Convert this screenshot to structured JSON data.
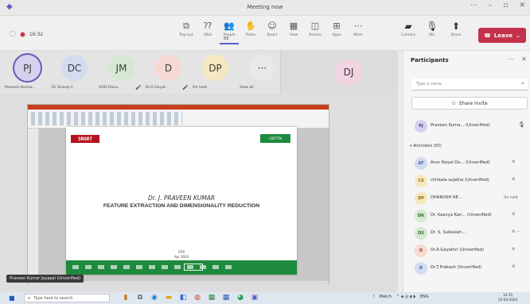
{
  "window": {
    "title": "Meeting now"
  },
  "toolbar": {
    "timer": "16:32",
    "tools": [
      {
        "label": "Pop out",
        "icon": "popout-icon",
        "glyph": "⧉"
      },
      {
        "label": "Q&A",
        "icon": "qa-icon",
        "glyph": "⁇"
      },
      {
        "label": "People",
        "icon": "people-icon",
        "glyph": "👥",
        "count": "88"
      },
      {
        "label": "Raise",
        "icon": "raise-hand-icon",
        "glyph": "✋"
      },
      {
        "label": "React",
        "icon": "react-icon",
        "glyph": "☺"
      },
      {
        "label": "View",
        "icon": "view-icon",
        "glyph": "▦"
      },
      {
        "label": "Rooms",
        "icon": "rooms-icon",
        "glyph": "◫"
      },
      {
        "label": "Apps",
        "icon": "apps-icon",
        "glyph": "⊞"
      },
      {
        "label": "More",
        "icon": "more-icon",
        "glyph": "⋯"
      }
    ],
    "devices": [
      {
        "label": "Camera",
        "icon": "camera-off-icon",
        "glyph": "▰"
      },
      {
        "label": "Mic",
        "icon": "mic-off-icon",
        "glyph": "🎙"
      },
      {
        "label": "Share",
        "icon": "share-icon",
        "glyph": "⬆"
      }
    ],
    "leave": "Leave"
  },
  "strip": {
    "tiles": [
      {
        "initials": "PJ",
        "name": "Praveen Kumar...",
        "bg": "#d7d0ee",
        "ring": "#6b59b8",
        "mic": false
      },
      {
        "initials": "DC",
        "name": "Dr Sivaraj C",
        "bg": "#d3dbf0",
        "ring": "",
        "mic": false
      },
      {
        "initials": "JM",
        "name": "HOD Ranu...",
        "bg": "#d5e8d2",
        "ring": "",
        "mic": true
      },
      {
        "initials": "D",
        "name": "Dr.A.Gayat...",
        "bg": "#f7d9d2",
        "ring": "",
        "mic": true
      },
      {
        "initials": "DP",
        "name": "On hold",
        "bg": "#f5e8c0",
        "ring": "",
        "mic": false
      },
      {
        "initials": "···",
        "name": "View all",
        "bg": "#e9e9e9",
        "ring": "",
        "mic": false
      }
    ],
    "spotlight": {
      "initials": "DJ",
      "bg": "#f2d3e1"
    }
  },
  "slide": {
    "logo_left": "SMART",
    "logo_right": "CRETTM",
    "author": "Dr. J. PRAVEEN KUMAR",
    "title": "FEATURE EXTRACTION AND DIMENSIONALITY REDUCTION",
    "event": "FDP",
    "date": "Apr 2024",
    "presenter_label": "Praveen Kumar Jayapal (Unverified)"
  },
  "panel": {
    "title": "Participants",
    "search_placeholder": "Type a name",
    "share_invite": "Share invite",
    "presenter": {
      "initials": "PJ",
      "name": "Praveen Kuma... (Unverified)",
      "bg": "#d7d0ee",
      "color": "#4b3e8c"
    },
    "attendees_label": "Attendees (83)",
    "attendees": [
      {
        "initials": "AT",
        "name": "Arun Noyal Do... (Unverified)",
        "bg": "#d3dbf0",
        "color": "#3b5aa8",
        "status": "⊘"
      },
      {
        "initials": "CS",
        "name": "chintala sujatha (Unverified)",
        "bg": "#f5e8c0",
        "color": "#8a6a10",
        "status": "⊘"
      },
      {
        "initials": "DP",
        "name": "DHANUSH RE...",
        "bg": "#f5e8c0",
        "color": "#8a6a10",
        "status": "On hold"
      },
      {
        "initials": "DK",
        "name": "Dr. Kaavya Kan... (Unverified)",
        "bg": "#d5e8d2",
        "color": "#2f6b2a",
        "status": "⊘"
      },
      {
        "initials": "DS",
        "name": "Dr. S. Sukkaiah...",
        "bg": "#d5e8d2",
        "color": "#2f6b2a",
        "status": "⊘ ⋯"
      },
      {
        "initials": "D",
        "name": "Dr.A.Gayathri (Unverified)",
        "bg": "#f7d9d2",
        "color": "#a33c2a",
        "status": "⊘"
      },
      {
        "initials": "D",
        "name": "Dr.T.Prakash (Unverified)",
        "bg": "#d3dbf0",
        "color": "#3b5aa8",
        "status": "⊘"
      }
    ]
  },
  "taskbar": {
    "search_placeholder": "Type here to search",
    "weather": "Match",
    "lang": "ENG",
    "time": "14:15",
    "date": "22-04-2024"
  }
}
